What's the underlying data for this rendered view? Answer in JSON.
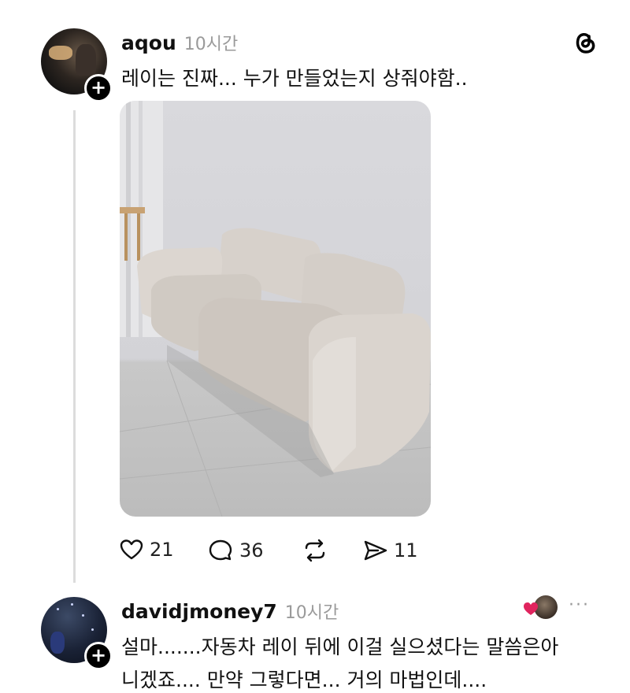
{
  "post": {
    "username": "aqou",
    "time": "10시간",
    "text": "레이는 진짜... 누가 만들었는지 상줘야함..",
    "actions": {
      "likes": "21",
      "comments": "36",
      "shares": "11"
    }
  },
  "reply": {
    "username": "davidjmoney7",
    "time": "10시간",
    "text_line1": "설마.......자동차 레이 뒤에 이걸 실으셨다는 말씀은아",
    "text_line2": "니겠죠.... 만약 그렇다면... 거의 마법인데....",
    "more": "···"
  },
  "icons": [
    "threads-logo-icon",
    "heart-icon",
    "comment-icon",
    "repost-icon",
    "send-icon",
    "plus-icon",
    "liked-heart-icon"
  ],
  "colors": {
    "text": "#111111",
    "muted": "#9a9a9a",
    "line": "#dcdcdc",
    "heart": "#e0245e"
  }
}
